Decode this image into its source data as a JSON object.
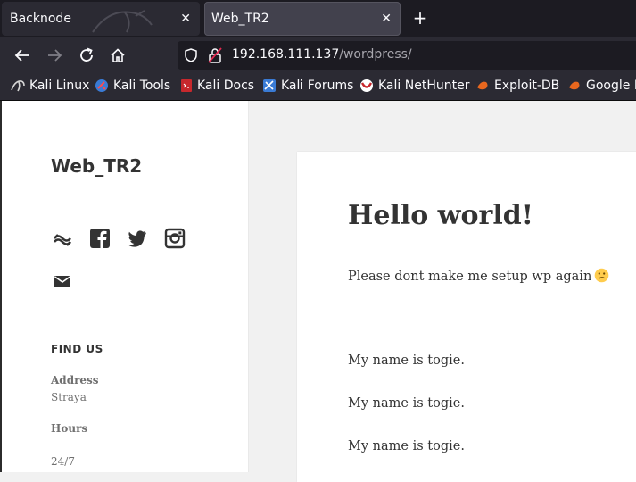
{
  "browser": {
    "tabs": [
      {
        "title": "Backnode",
        "active": false
      },
      {
        "title": "Web_TR2",
        "active": true
      }
    ],
    "close_glyph": "✕",
    "new_tab_glyph": "+",
    "url_host": "192.168.111.137",
    "url_path": "/wordpress/",
    "bookmarks": [
      "Kali Linux",
      "Kali Tools",
      "Kali Docs",
      "Kali Forums",
      "Kali NetHunter",
      "Exploit-DB",
      "Google Hacking DB"
    ]
  },
  "sidebar": {
    "site_title": "Web_TR2",
    "social_icons": [
      "wordpress-icon",
      "facebook-icon",
      "twitter-icon",
      "instagram-icon",
      "email-icon"
    ],
    "widget_title": "FIND US",
    "address_label": "Address",
    "address_value": "Straya",
    "hours_label": "Hours",
    "hours_value": "24/7"
  },
  "post": {
    "title": "Hello world!",
    "paragraphs": [
      "Please dont make me setup wp again",
      "My name is togie.",
      "My name is togie.",
      "My name is togie."
    ]
  },
  "colors": {
    "tabbar_bg": "#1c1b22",
    "toolbar_bg": "#2b2a33",
    "active_tab_bg": "#42414d",
    "page_bg": "#f1f1f1",
    "text_dark": "#333333"
  }
}
